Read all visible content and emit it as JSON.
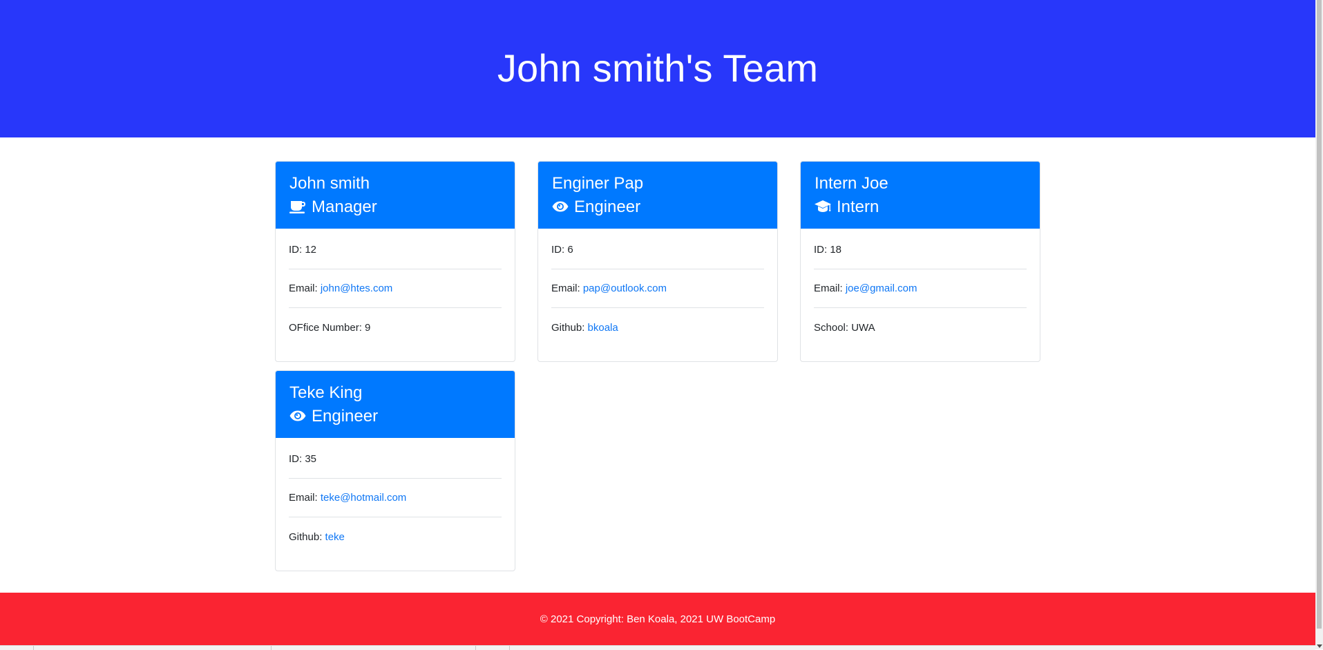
{
  "header": {
    "title": "John smith's Team",
    "bg_color": "#2837fa"
  },
  "cards": [
    {
      "name": "John smith",
      "role": "Manager",
      "role_icon": "coffee-mug-icon",
      "id_label": "ID: ",
      "id_value": "12",
      "email_label": "Email: ",
      "email": "john@htes.com",
      "extra_label": "OFfice Number: ",
      "extra_value": "9"
    },
    {
      "name": "Enginer Pap",
      "role": "Engineer",
      "role_icon": "eye-icon",
      "id_label": "ID: ",
      "id_value": "6",
      "email_label": "Email: ",
      "email": "pap@outlook.com",
      "extra_label": "Github: ",
      "extra_value": "bkoala"
    },
    {
      "name": "Intern Joe",
      "role": "Intern",
      "role_icon": "graduation-cap-icon",
      "id_label": "ID: ",
      "id_value": "18",
      "email_label": "Email: ",
      "email": "joe@gmail.com",
      "extra_label": "School: ",
      "extra_value": "UWA"
    },
    {
      "name": "Teke King",
      "role": "Engineer",
      "role_icon": "eye-icon",
      "id_label": "ID: ",
      "id_value": "35",
      "email_label": "Email: ",
      "email": "teke@hotmail.com",
      "extra_label": "Github: ",
      "extra_value": "teke"
    }
  ],
  "footer": {
    "text": "© 2021 Copyright: Ben Koala, 2021 UW BootCamp",
    "bg_color": "#fa2432"
  },
  "colors": {
    "card_header": "#0079ff",
    "link": "#0f77f5"
  }
}
